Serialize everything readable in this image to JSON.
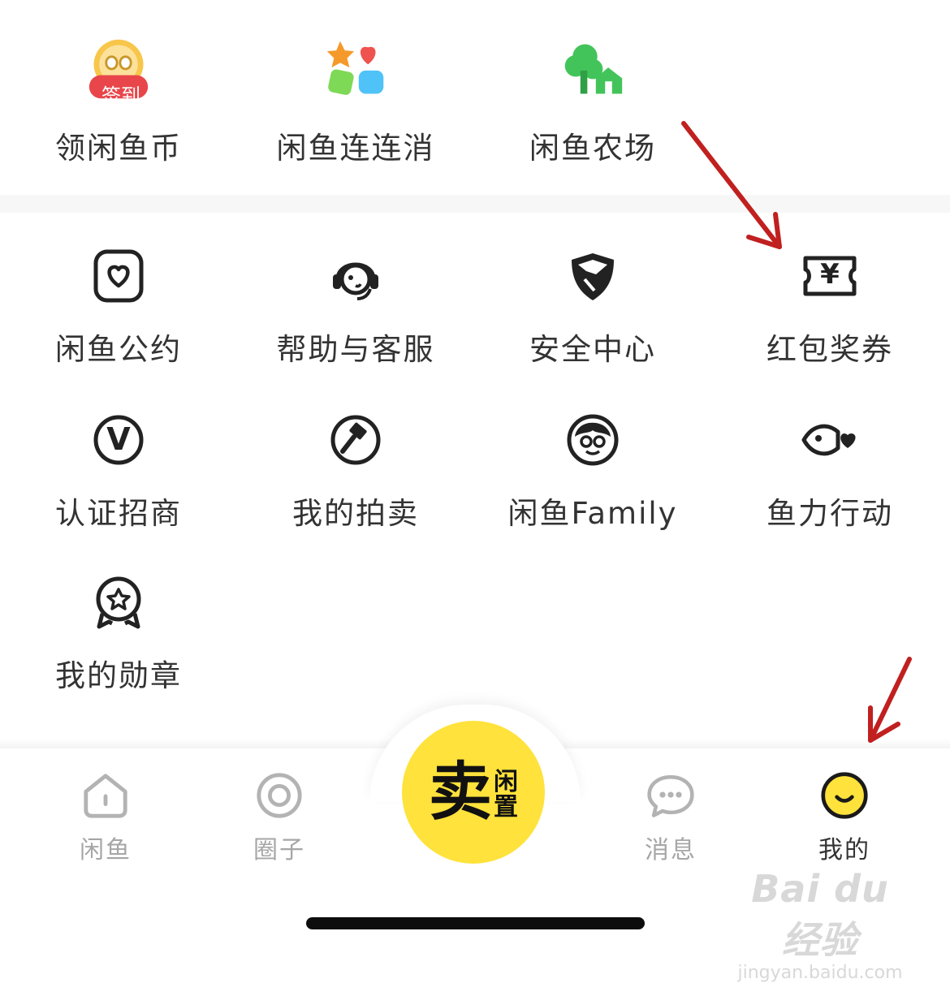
{
  "top_row": [
    {
      "label": "领闲鱼币",
      "icon": "sign-in-coin-icon",
      "badge": "签到"
    },
    {
      "label": "闲鱼连连消",
      "icon": "match-game-icon"
    },
    {
      "label": "闲鱼农场",
      "icon": "farm-icon"
    }
  ],
  "tools": [
    {
      "label": "闲鱼公约",
      "icon": "convention-heart-icon"
    },
    {
      "label": "帮助与客服",
      "icon": "customer-service-icon"
    },
    {
      "label": "安全中心",
      "icon": "shield-icon"
    },
    {
      "label": "红包奖券",
      "icon": "coupon-icon",
      "symbol": "¥"
    },
    {
      "label": "认证招商",
      "icon": "verified-v-icon",
      "symbol": "V"
    },
    {
      "label": "我的拍卖",
      "icon": "auction-hammer-icon"
    },
    {
      "label": "闲鱼Family",
      "icon": "family-monkey-icon"
    },
    {
      "label": "鱼力行动",
      "icon": "fish-heart-icon"
    },
    {
      "label": "我的勋章",
      "icon": "medal-icon"
    }
  ],
  "tabbar": {
    "tabs": [
      {
        "label": "闲鱼",
        "icon": "home-icon",
        "active": false
      },
      {
        "label": "圈子",
        "icon": "circle-icon",
        "active": false
      },
      {
        "label": "消息",
        "icon": "message-icon",
        "active": false
      },
      {
        "label": "我的",
        "icon": "smiley-profile-icon",
        "active": true
      }
    ],
    "sell": {
      "big": "卖",
      "small1": "闲",
      "small2": "置"
    }
  },
  "watermark": {
    "line1": "Bai du 经验",
    "line2": "jingyan.baidu.com"
  },
  "colors": {
    "accent": "#ffe23b",
    "arrow": "#c0201f",
    "text": "#333333",
    "inactive": "#a6a6a6"
  }
}
